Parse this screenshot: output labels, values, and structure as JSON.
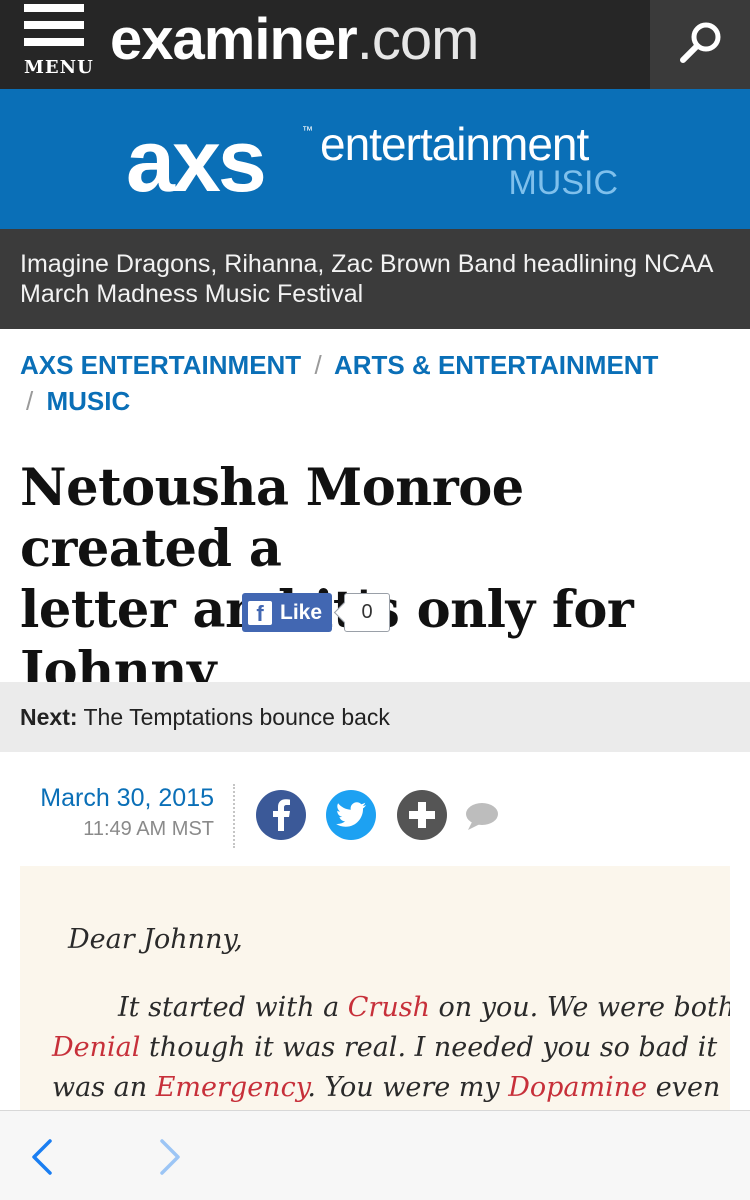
{
  "header": {
    "menu_label": "MENU",
    "logo_brand": "examiner",
    "logo_tld": ".com"
  },
  "banner": {
    "logo": "axs",
    "tm": "™",
    "title": "entertainment",
    "subtitle": "MUSIC"
  },
  "top_headline": "Imagine Dragons, Rihanna, Zac Brown Band headlining NCAA March Madness Music Festival",
  "breadcrumb": {
    "items": [
      "AXS ENTERTAINMENT",
      "ARTS & ENTERTAINMENT",
      "MUSIC"
    ],
    "separator": "/"
  },
  "article": {
    "title_line1": "Netousha Monroe created a",
    "title_line2": "letter and it's only for",
    "title_line3": "Johnny",
    "like_label": "Like",
    "like_count": "0"
  },
  "next": {
    "label": "Next:",
    "title": "The Temptations bounce back"
  },
  "meta": {
    "date": "March 30, 2015",
    "time": "11:49 AM MST"
  },
  "letter": {
    "greeting": "Dear Johnny,",
    "l1a": "It started with a ",
    "l1b": "Crush",
    "l1c": " on you. We were both in",
    "l2a": "Denial",
    "l2b": " though it was real. I needed you so bad it",
    "l3a": "was an ",
    "l3b": "Emergency",
    "l3c": ". You were my ",
    "l3d": "Dopamine",
    "l3e": " even though"
  },
  "colors": {
    "topbar": "#262626",
    "axs_blue": "#0a6fb7",
    "headline_strip": "#3b3b3b",
    "next_strip": "#ebebeb",
    "facebook": "#3b5998",
    "twitter": "#1da1f2",
    "letter_red": "#c7303a"
  },
  "icons": {
    "menu": "hamburger-icon",
    "search": "search-icon",
    "facebook_share": "facebook-icon",
    "twitter_share": "twitter-icon",
    "more_share": "plus-icon",
    "comments": "comment-icon",
    "back": "chevron-left-icon",
    "forward": "chevron-right-icon"
  }
}
